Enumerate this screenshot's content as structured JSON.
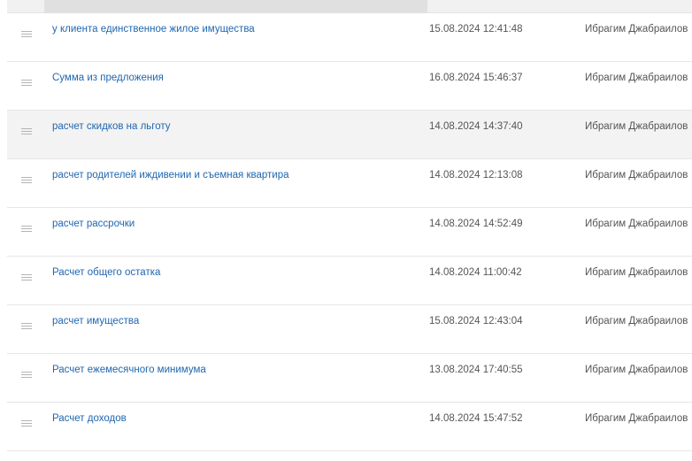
{
  "rows": [
    {
      "name": "у клиента единственное жилое имущества",
      "date": "15.08.2024 12:41:48",
      "author": "Ибрагим Джабраилов"
    },
    {
      "name": "Сумма из предложения",
      "date": "16.08.2024 15:46:37",
      "author": "Ибрагим Джабраилов"
    },
    {
      "name": "расчет скидков на льготу",
      "date": "14.08.2024 14:37:40",
      "author": "Ибрагим Джабраилов"
    },
    {
      "name": "расчет родителей иждивении и съемная квартира",
      "date": "14.08.2024 12:13:08",
      "author": "Ибрагим Джабраилов"
    },
    {
      "name": "расчет рассрочки",
      "date": "14.08.2024 14:52:49",
      "author": "Ибрагим Джабраилов"
    },
    {
      "name": "Расчет общего остатка",
      "date": "14.08.2024 11:00:42",
      "author": "Ибрагим Джабраилов"
    },
    {
      "name": "расчет имущества",
      "date": "15.08.2024 12:43:04",
      "author": "Ибрагим Джабраилов"
    },
    {
      "name": "Расчет ежемесячного минимума",
      "date": "13.08.2024 17:40:55",
      "author": "Ибрагим Джабраилов"
    },
    {
      "name": "Расчет доходов",
      "date": "14.08.2024 15:47:52",
      "author": "Ибрагим Джабраилов"
    }
  ],
  "colors": {
    "link": "#2067b0",
    "text": "#555555",
    "row_highlight": "#f3f3f3",
    "header_bg": "#f1f1f1"
  },
  "icons": {
    "row_handle": "drag-handle-icon"
  }
}
